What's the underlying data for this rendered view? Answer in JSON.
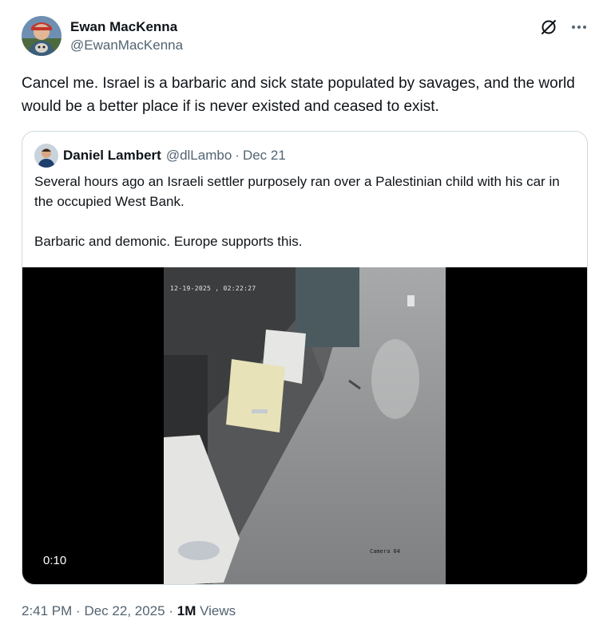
{
  "author": {
    "display_name": "Ewan MacKenna",
    "handle": "@EwanMacKenna"
  },
  "header_icons": {
    "grok": "grok-icon",
    "more": "more-icon"
  },
  "tweet": {
    "text": "Cancel me. Israel is a barbaric and sick state populated by savages, and the world would be a better place if is never existed and ceased to exist."
  },
  "quoted_tweet": {
    "display_name": "Daniel Lambert",
    "handle": "@dlLambo",
    "separator": "·",
    "date": "Dec 21",
    "paragraphs": [
      "Several hours ago an Israeli settler purposely ran over a Palestinian child with his car in the occupied West Bank.",
      "Barbaric and demonic. Europe supports this."
    ],
    "video": {
      "overlay_timestamp": "12-19-2025 , 02:22:27",
      "camera_label": "Camera 04",
      "duration": "0:10"
    }
  },
  "meta": {
    "time": "2:41 PM",
    "separator": "·",
    "date": "Dec 22, 2025",
    "views_count": "1M",
    "views_label": "Views"
  },
  "colors": {
    "text_primary": "#0f1419",
    "text_secondary": "#536471",
    "border": "#cfd9de"
  }
}
